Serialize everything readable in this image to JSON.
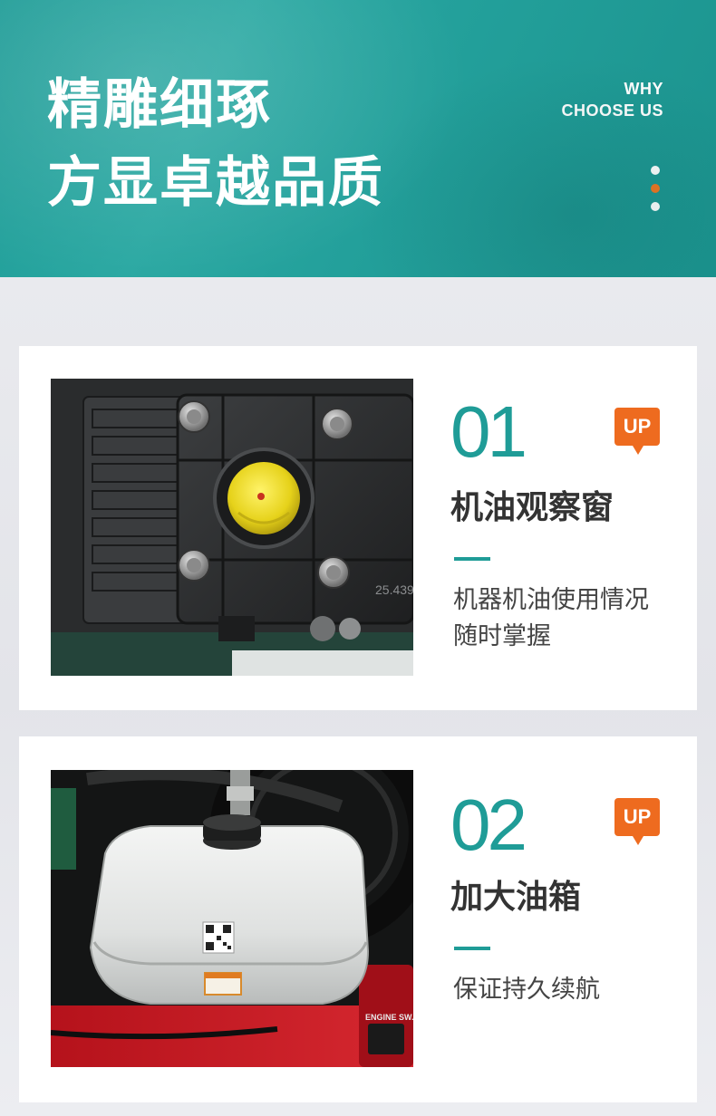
{
  "header": {
    "title_line1": "精雕细琢",
    "title_line2": "方显卓越品质",
    "why_line1": "WHY",
    "why_line2": "CHOOSE US",
    "accent_color": "#1f9c97",
    "dot_accent_color": "#f07722"
  },
  "features": [
    {
      "number": "01",
      "badge": "UP",
      "title": "机油观察窗",
      "desc_line1": "机器机油使用情况",
      "desc_line2": "随时掌握",
      "photo_label": "25.439"
    },
    {
      "number": "02",
      "badge": "UP",
      "title": "加大油箱",
      "desc_line1": "保证持久续航",
      "photo_label": "ENGINE SW."
    }
  ]
}
